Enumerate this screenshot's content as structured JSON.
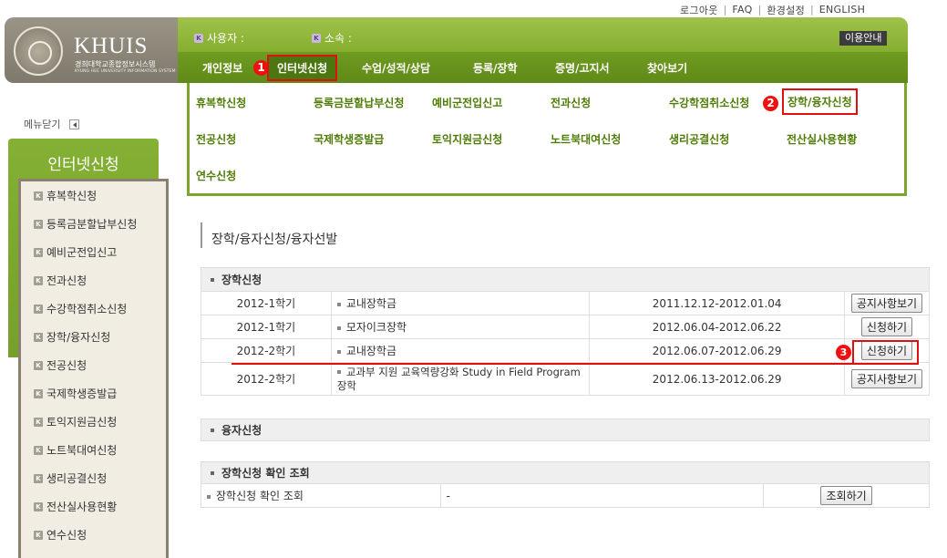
{
  "util": {
    "logout": "로그아웃",
    "faq": "FAQ",
    "settings": "환경설정",
    "english": "ENGLISH"
  },
  "logo": {
    "name": "KHUIS",
    "subtitle": "경희대학교종합정보시스템",
    "english": "KYUNG HEE UNIVERSITY INFORMATION SYSTEM"
  },
  "header": {
    "user_label": "사용자 :",
    "affiliation_label": "소속 :",
    "guide": "이용안내",
    "badge": "K"
  },
  "nav": [
    "개인정보",
    "인터넷신청",
    "수업/성적/상담",
    "등록/장학",
    "증명/고지서",
    "찾아보기"
  ],
  "markers": {
    "one": "1",
    "two": "2",
    "three": "3"
  },
  "submenu": {
    "row1": [
      "휴복학신청",
      "등록금분할납부신청",
      "예비군전입신고",
      "전과신청",
      "수강학점취소신청",
      "장학/융자신청"
    ],
    "row2": [
      "전공신청",
      "국제학생증발급",
      "토익지원금신청",
      "노트북대여신청",
      "생리공결신청",
      "전산실사용현황"
    ],
    "row3": [
      "연수신청"
    ]
  },
  "sidebar": {
    "menu_close": "메뉴닫기",
    "title": "인터넷신청",
    "items": [
      "휴복학신청",
      "등록금분할납부신청",
      "예비군전입신고",
      "전과신청",
      "수강학점취소신청",
      "장학/융자신청",
      "전공신청",
      "국제학생증발급",
      "토익지원금신청",
      "노트북대여신청",
      "생리공결신청",
      "전산실사용현황",
      "연수신청"
    ]
  },
  "page_title": "장학/융자신청/융자선발",
  "scholarship": {
    "title": "장학신청",
    "rows": [
      {
        "term": "2012-1학기",
        "name": "교내장학금",
        "period": "2011.12.12-2012.01.04",
        "action": "공지사항보기"
      },
      {
        "term": "2012-1학기",
        "name": "모자이크장학",
        "period": "2012.06.04-2012.06.22",
        "action": "신청하기"
      },
      {
        "term": "2012-2학기",
        "name": "교내장학금",
        "period": "2012.06.07-2012.06.29",
        "action": "신청하기"
      },
      {
        "term": "2012-2학기",
        "name": "교과부 지원 교육역량강화 Study in Field Program 장학",
        "period": "2012.06.13-2012.06.29",
        "action": "공지사항보기"
      }
    ]
  },
  "loan": {
    "title": "융자신청"
  },
  "check": {
    "title": "장학신청 확인 조회",
    "row": {
      "label": "장학신청 확인 조회",
      "value": "-",
      "action": "조회하기"
    }
  }
}
